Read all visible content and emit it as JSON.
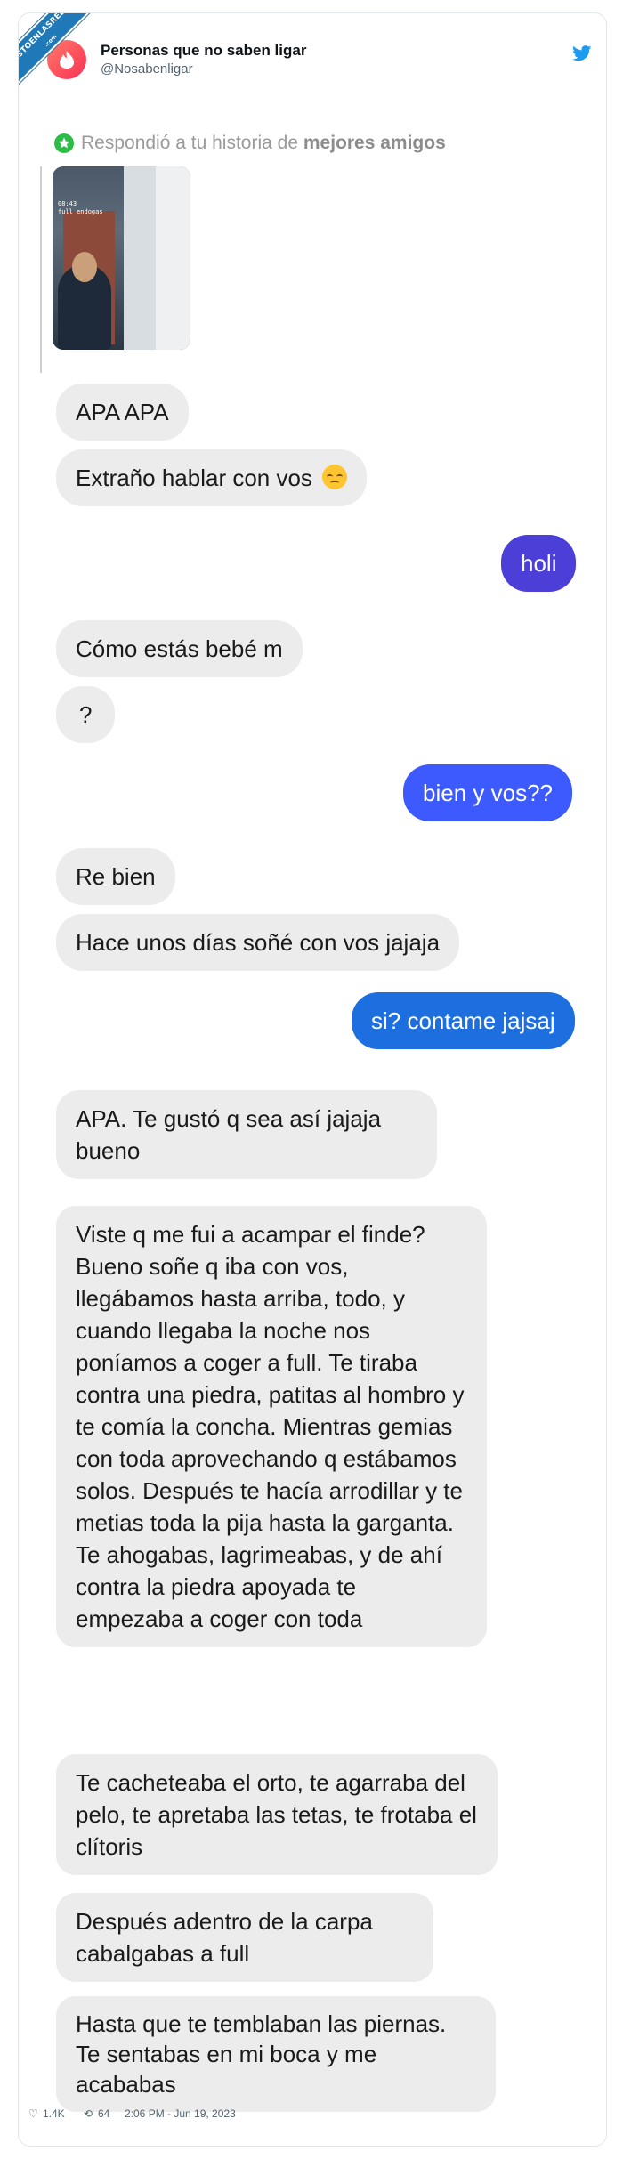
{
  "watermark": {
    "line1": "VISTOENLASREDES",
    "line2": ".com"
  },
  "tweet": {
    "display_name": "Personas que no saben ligar",
    "handle": "@Nosabenligar",
    "brand_color": "#1d9bf0",
    "likes": "1.4K",
    "retweets": "64",
    "timestamp": "2:06 PM - Jun 19, 2023"
  },
  "chat": {
    "reply_prefix": "Respondió a tu historia de",
    "reply_bold": "mejores amigos",
    "story_caption": "08:43\nfull endogas",
    "messages": [
      {
        "id": "m1",
        "side": "in",
        "text": "APA APA"
      },
      {
        "id": "m2",
        "side": "in",
        "text": "Extraño hablar con vos",
        "emoji": "disappointed-face"
      },
      {
        "id": "m3",
        "side": "out",
        "text": "holi"
      },
      {
        "id": "m4",
        "side": "in",
        "text": "Cómo estás bebé m"
      },
      {
        "id": "m5",
        "side": "in",
        "text": "?"
      },
      {
        "id": "m6",
        "side": "out",
        "text": "bien y vos??"
      },
      {
        "id": "m7",
        "side": "in",
        "text": "Re bien"
      },
      {
        "id": "m8",
        "side": "in",
        "text": "Hace unos días soñé con vos jajaja"
      },
      {
        "id": "m9",
        "side": "out",
        "text": "si? contame jajsaj"
      },
      {
        "id": "m10",
        "side": "in",
        "text": "APA. Te gustó q sea así jajaja bueno"
      },
      {
        "id": "m11",
        "side": "in",
        "text": "Viste q me fui a acampar el finde? Bueno soñe q iba con vos, llegábamos hasta arriba, todo, y cuando llegaba la noche nos poníamos a coger a full. Te tiraba contra una piedra, patitas al hombro y te comía la concha. Mientras gemias con toda aprovechando q estábamos solos. Después te hacía arrodillar y te metias toda la pija hasta la garganta. Te ahogabas, lagrimeabas, y de ahí contra la piedra apoyada te empezaba a coger con toda"
      },
      {
        "id": "m12",
        "side": "in",
        "text": "Te cacheteaba el orto, te agarraba del pelo, te apretaba las tetas, te frotaba el clítoris"
      },
      {
        "id": "m13",
        "side": "in",
        "text": "Después adentro de la carpa cabalgabas a full"
      },
      {
        "id": "m14",
        "side": "in",
        "text": "Hasta que te temblaban las piernas. Te sentabas en mi boca y me acababas"
      }
    ]
  }
}
